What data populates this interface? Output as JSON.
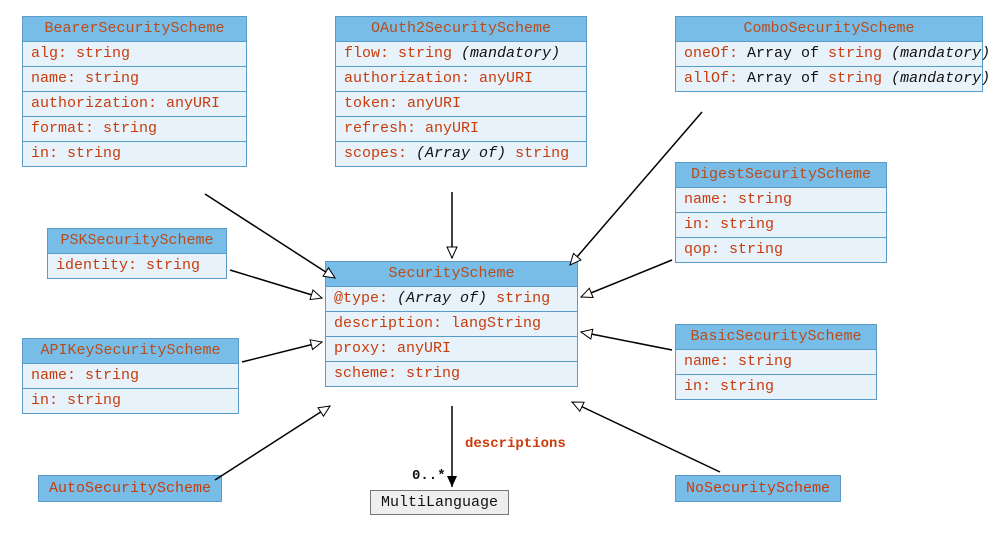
{
  "classes": {
    "bearer": {
      "title": "BearerSecurityScheme",
      "rows": [
        {
          "name": "alg",
          "type": "string"
        },
        {
          "name": "name",
          "type": "string"
        },
        {
          "name": "authorization",
          "type": "anyURI"
        },
        {
          "name": "format",
          "type": "string"
        },
        {
          "name": "in",
          "type": "string"
        }
      ]
    },
    "oauth2": {
      "title": "OAuth2SecurityScheme",
      "rows": [
        {
          "name": "flow",
          "type": "string",
          "mandatory": true
        },
        {
          "name": "authorization",
          "type": "anyURI"
        },
        {
          "name": "token",
          "type": "anyURI"
        },
        {
          "name": "refresh",
          "type": "anyURI"
        },
        {
          "name": "scopes",
          "type": "string",
          "arrayOfParen": true
        }
      ]
    },
    "combo": {
      "title": "ComboSecurityScheme",
      "rows": [
        {
          "name": "oneOf",
          "type": "string",
          "arrayOf": true,
          "mandatory": true
        },
        {
          "name": "allOf",
          "type": "string",
          "arrayOf": true,
          "mandatory": true
        }
      ]
    },
    "digest": {
      "title": "DigestSecurityScheme",
      "rows": [
        {
          "name": "name",
          "type": "string"
        },
        {
          "name": "in",
          "type": "string"
        },
        {
          "name": "qop",
          "type": "string"
        }
      ]
    },
    "psk": {
      "title": "PSKSecurityScheme",
      "rows": [
        {
          "name": "identity",
          "type": "string"
        }
      ]
    },
    "security": {
      "title": "SecurityScheme",
      "rows": [
        {
          "name": "@type",
          "type": "string",
          "arrayOfParen": true
        },
        {
          "name": "description",
          "type": "langString"
        },
        {
          "name": "proxy",
          "type": "anyURI"
        },
        {
          "name": "scheme",
          "type": "string"
        }
      ]
    },
    "basic": {
      "title": "BasicSecurityScheme",
      "rows": [
        {
          "name": "name",
          "type": "string"
        },
        {
          "name": "in",
          "type": "string"
        }
      ]
    },
    "apikey": {
      "title": "APIKeySecurityScheme",
      "rows": [
        {
          "name": "name",
          "type": "string"
        },
        {
          "name": "in",
          "type": "string"
        }
      ]
    },
    "auto": {
      "title": "AutoSecurityScheme"
    },
    "nosec": {
      "title": "NoSecurityScheme"
    },
    "multilang": {
      "title": "MultiLanguage"
    },
    "assoc": {
      "label": "descriptions",
      "multiplicity": "0..*"
    }
  },
  "chart_data": {
    "type": "table",
    "title": "SecurityScheme class hierarchy",
    "central_class": "SecurityScheme",
    "subclasses": [
      "BearerSecurityScheme",
      "OAuth2SecurityScheme",
      "ComboSecurityScheme",
      "DigestSecurityScheme",
      "PSKSecurityScheme",
      "APIKeySecurityScheme",
      "AutoSecurityScheme",
      "BasicSecurityScheme",
      "NoSecurityScheme"
    ],
    "attributes": {
      "SecurityScheme": [
        {
          "name": "@type",
          "type": "(Array of) string"
        },
        {
          "name": "description",
          "type": "langString"
        },
        {
          "name": "proxy",
          "type": "anyURI"
        },
        {
          "name": "scheme",
          "type": "string"
        }
      ],
      "BearerSecurityScheme": [
        {
          "name": "alg",
          "type": "string"
        },
        {
          "name": "name",
          "type": "string"
        },
        {
          "name": "authorization",
          "type": "anyURI"
        },
        {
          "name": "format",
          "type": "string"
        },
        {
          "name": "in",
          "type": "string"
        }
      ],
      "OAuth2SecurityScheme": [
        {
          "name": "flow",
          "type": "string",
          "mandatory": true
        },
        {
          "name": "authorization",
          "type": "anyURI"
        },
        {
          "name": "token",
          "type": "anyURI"
        },
        {
          "name": "refresh",
          "type": "anyURI"
        },
        {
          "name": "scopes",
          "type": "(Array of) string"
        }
      ],
      "ComboSecurityScheme": [
        {
          "name": "oneOf",
          "type": "Array of string",
          "mandatory": true
        },
        {
          "name": "allOf",
          "type": "Array of string",
          "mandatory": true
        }
      ],
      "DigestSecurityScheme": [
        {
          "name": "name",
          "type": "string"
        },
        {
          "name": "in",
          "type": "string"
        },
        {
          "name": "qop",
          "type": "string"
        }
      ],
      "PSKSecurityScheme": [
        {
          "name": "identity",
          "type": "string"
        }
      ],
      "APIKeySecurityScheme": [
        {
          "name": "name",
          "type": "string"
        },
        {
          "name": "in",
          "type": "string"
        }
      ],
      "BasicSecurityScheme": [
        {
          "name": "name",
          "type": "string"
        },
        {
          "name": "in",
          "type": "string"
        }
      ],
      "AutoSecurityScheme": [],
      "NoSecurityScheme": []
    },
    "associations": [
      {
        "from": "SecurityScheme",
        "to": "MultiLanguage",
        "role": "descriptions",
        "multiplicity": "0..*"
      }
    ]
  }
}
